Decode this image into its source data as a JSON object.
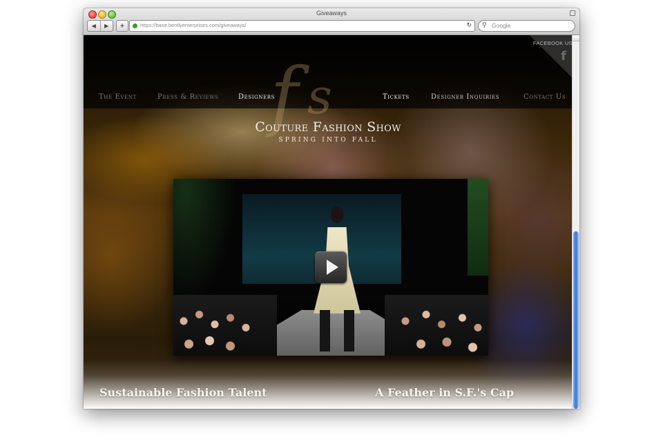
{
  "window": {
    "title": "Giveaways",
    "url": "https://base.bentlyenterprises.com/giveaways/",
    "search_placeholder": "Google",
    "nav_back_icon": "◀",
    "nav_forward_icon": "▶",
    "add_icon": "+",
    "reload_icon": "↻",
    "search_icon": "🔍"
  },
  "social": {
    "facebook_label": "FACEBOOK US",
    "facebook_icon": "f"
  },
  "nav": {
    "left": [
      "The Event",
      "Press & Reviews",
      "Designers"
    ],
    "right": [
      "Tickets",
      "Designer Inquiries",
      "Contact Us"
    ]
  },
  "logo": {
    "monogram_1": "f",
    "monogram_2": "s",
    "title": "Couture Fashion Show",
    "subtitle": "SPRING INTO FALL"
  },
  "video": {
    "play_icon": "play"
  },
  "features": [
    "Sustainable Fashion Talent",
    "A Feather in S.F.'s Cap"
  ],
  "colors": {
    "nav_dim": "#7b7b7b",
    "nav_bright": "#efefef",
    "scroll_thumb": "#3a79d6"
  }
}
